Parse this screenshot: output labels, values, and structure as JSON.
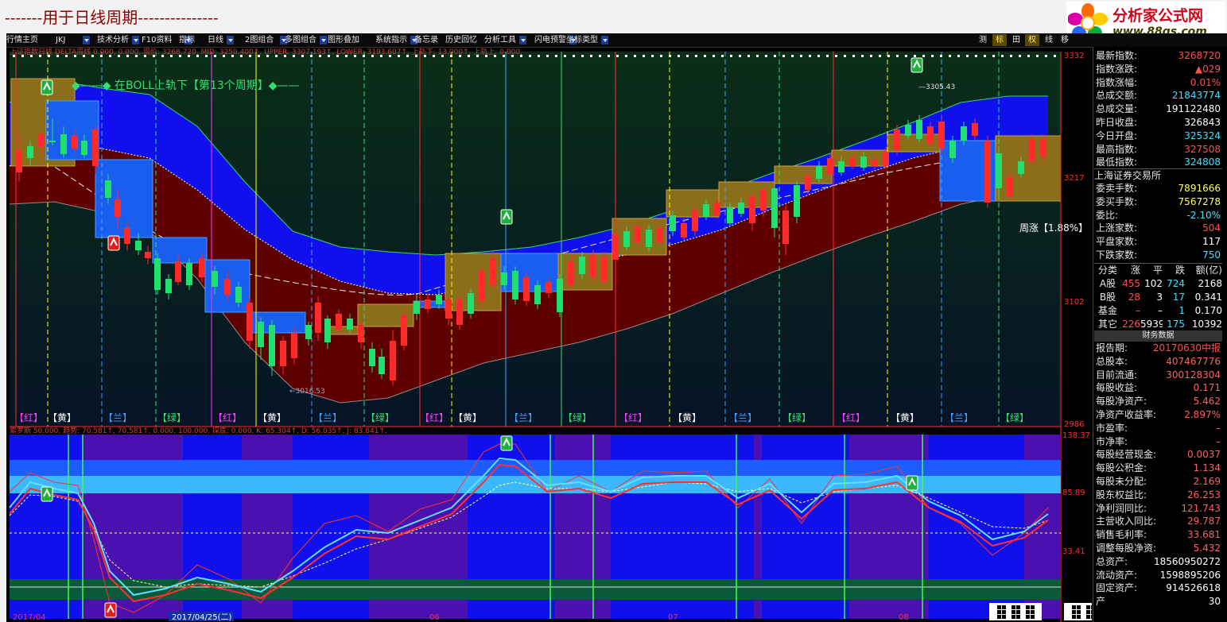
{
  "page_title": "-------用于日线周期---------------",
  "logo": {
    "name": "分析家公式网",
    "url": "www.88gs.com"
  },
  "toolbar": {
    "items": [
      {
        "label": "行情主页",
        "arrow": false
      },
      {
        "label": "JKJ",
        "arrow": true
      },
      {
        "label": "技术分析",
        "arrow": true
      },
      {
        "label": "F10资料",
        "arrow": true
      },
      {
        "label": "指标",
        "arrow": false
      },
      {
        "label": "日线",
        "arrow": true
      },
      {
        "label": "2图组合",
        "arrow": true
      },
      {
        "label": "多图组合",
        "arrow": true
      },
      {
        "label": "图形叠加",
        "arrow": false
      },
      {
        "label": "系统指示",
        "arrow": true
      },
      {
        "label": "备忘录",
        "arrow": false
      },
      {
        "label": "历史回忆",
        "arrow": false
      },
      {
        "label": "分析工具",
        "arrow": true
      },
      {
        "label": "闪电预警",
        "arrow": true
      },
      {
        "label": "坐标类型",
        "arrow": true
      }
    ],
    "right": [
      "测",
      "标",
      "田",
      "权",
      "线",
      "移"
    ]
  },
  "main_chart": {
    "info_line": "上证指数日线 DELTA周线 0.000, 0.000, 现价: 3268.720, MID: 3250.400↑, UPPER: 3307.193↑, LOWER: 3193.607↑, 上轨下: 13.000↑, 上轨上: 0.000,",
    "annotation": "◆——◆ 在BOLL上轨下【第13个周期】◆——",
    "weekly_label": "周涨【1.88%】",
    "high_marker": "3305.43",
    "low_marker": "3016.53",
    "y_labels": [
      "3332",
      "3217",
      "3102",
      "2986"
    ],
    "phase_labels": [
      "【红】",
      "【黄】",
      "【兰】",
      "【绿】",
      "【红】",
      "【黄】",
      "【兰】",
      "【绿】",
      "【红】",
      "【黄】",
      "【兰】",
      "【绿】",
      "【红】",
      "【黄】",
      "【兰】",
      "【绿】",
      "【红】",
      "【黄】",
      "【兰】",
      "【绿】"
    ]
  },
  "sub_chart": {
    "info_line": "索罗斯 50.000, 趋势: 70.581↑, 70.581↑, 0.000, 100.000, 探底: 0.000, K: 65.304↑, D: 56.035↑, J: 83.841↑,",
    "y_labels": [
      "138.37",
      "85.89",
      "33.41"
    ]
  },
  "date_labels": [
    "2017/04",
    "2017/04/25(二)",
    "06",
    "07",
    "08"
  ],
  "quote_panel": [
    {
      "label": "最新指数:",
      "value": "3268720",
      "color": "#ff5050"
    },
    {
      "label": "指数涨跌:",
      "value": "▲029",
      "color": "#ff5050"
    },
    {
      "label": "指数涨幅:",
      "value": "0.01%",
      "color": "#ff5050"
    },
    {
      "label": "总成交额:",
      "value": "21843774",
      "color": "#40e0ff"
    },
    {
      "label": "总成交量:",
      "value": "191122480",
      "color": "#ffffff"
    },
    {
      "label": "昨日收盘:",
      "value": "326843",
      "color": "#ffffff"
    },
    {
      "label": "今日开盘:",
      "value": "325324",
      "color": "#40e0ff"
    },
    {
      "label": "最高指数:",
      "value": "327508",
      "color": "#ff5050"
    },
    {
      "label": "最低指数:",
      "value": "324808",
      "color": "#40e0ff"
    }
  ],
  "exchange": {
    "name": "上海证券交易所",
    "rows": [
      {
        "label": "委卖手数:",
        "value": "7891666",
        "color": "#ffff60"
      },
      {
        "label": "委买手数:",
        "value": "7567278",
        "color": "#ffff60"
      },
      {
        "label": "委比:",
        "value": "-2.10%",
        "color": "#40e0ff"
      },
      {
        "label": "上涨家数:",
        "value": "504",
        "color": "#ff5050"
      },
      {
        "label": "平盘家数:",
        "value": "117",
        "color": "#ffffff"
      },
      {
        "label": "下跌家数:",
        "value": "750",
        "color": "#40e0ff"
      }
    ]
  },
  "breadth_table": {
    "headers": [
      "分类",
      "涨",
      "平",
      "跌",
      "额(亿)"
    ],
    "rows": [
      [
        "A股",
        "455",
        "102",
        "724",
        "2168"
      ],
      [
        "B股",
        "28",
        "3",
        "17",
        "0.341"
      ],
      [
        "基金",
        "–",
        "–",
        "1",
        "0.170"
      ],
      [
        "其它",
        "226",
        "5939",
        "175",
        "10392"
      ]
    ]
  },
  "financials": {
    "header": "财务数据",
    "rows": [
      {
        "label": "报告期:",
        "value": "20170630中报"
      },
      {
        "label": "总股本:",
        "value": "407467776"
      },
      {
        "label": "目前流通:",
        "value": "300128304"
      },
      {
        "label": "每股收益:",
        "value": "0.171"
      },
      {
        "label": "每股净资产:",
        "value": "5.462"
      },
      {
        "label": "净资产收益率:",
        "value": "2.897%"
      },
      {
        "label": "市盈率:",
        "value": "–"
      },
      {
        "label": "市净率:",
        "value": "–"
      },
      {
        "label": "每股经营现金:",
        "value": "0.0037"
      },
      {
        "label": "每股公积金:",
        "value": "1.134"
      },
      {
        "label": "每股未分配:",
        "value": "2.169"
      },
      {
        "label": "股东权益比:",
        "value": "26.253"
      },
      {
        "label": "净利润同比:",
        "value": "121.743"
      },
      {
        "label": "主营收入同比:",
        "value": "29.787"
      },
      {
        "label": "销售毛利率:",
        "value": "33.681"
      },
      {
        "label": "调整每股净资:",
        "value": "5.432"
      },
      {
        "label": "总资产:",
        "value": "18560950272"
      },
      {
        "label": "流动资产:",
        "value": "1598895206"
      },
      {
        "label": "固定资产:",
        "value": "914526618"
      },
      {
        "label": "产",
        "value": "30"
      }
    ]
  },
  "colors": {
    "upper_band": "#1010ee",
    "lower_band": "#5e0000",
    "yellow_box": "#8b6e1a",
    "blue_box": "#1a5ef0",
    "candle_up": "#ff2a2a",
    "candle_down": "#20e070"
  }
}
